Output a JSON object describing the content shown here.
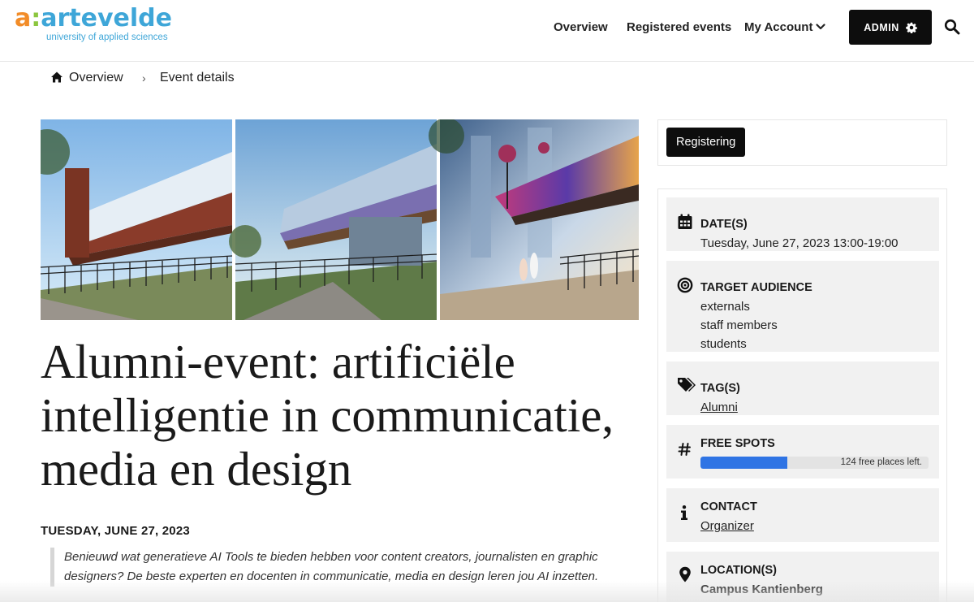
{
  "brand": {
    "logo_a": "a",
    "logo_colon": ":",
    "logo_word": "artevelde",
    "logo_sub": "university of applied sciences"
  },
  "nav": {
    "overview": "Overview",
    "registered": "Registered events",
    "account": "My Account",
    "admin": "ADMIN"
  },
  "breadcrumb": {
    "overview": "Overview",
    "separator": "›",
    "current": "Event details"
  },
  "event": {
    "title": "Alumni-event: artificiële intelli­gentie in communicatie, media en design",
    "date_heading": "TUESDAY, JUNE 27, 2023",
    "intro": "Benieuwd wat generatieve AI Tools te bieden hebben voor content creators, journalisten en graphic designers? De beste experten en docenten in communicatie, media en design leren jou AI inzetten."
  },
  "sidebar": {
    "register_button": "Registering",
    "date": {
      "title": "DATE(S)",
      "value": "Tuesday, June 27, 2023 13:00-19:00"
    },
    "audience": {
      "title": "TARGET AUDIENCE",
      "items": [
        "externals",
        "staff members",
        "students"
      ]
    },
    "tags": {
      "title": "TAG(S)",
      "value": "Alumni"
    },
    "spots": {
      "title": "FREE SPOTS",
      "label": "124 free places left.",
      "fill_fraction": 0.38
    },
    "contact": {
      "title": "CONTACT",
      "value": "Organizer"
    },
    "location": {
      "title": "LOCATION(S)",
      "value": "Campus Kantienberg"
    }
  },
  "colors": {
    "brand_blue": "#3ea6d8",
    "brand_orange": "#f28c28",
    "brand_green": "#8cc63f",
    "progress_blue": "#2f74e4",
    "button_black": "#0d0d0d"
  },
  "icons": {
    "home": "home-icon",
    "chevron": "chevron-down-icon",
    "gear": "gear-icon",
    "search": "search-icon",
    "calendar": "calendar-icon",
    "target": "target-icon",
    "tag": "tag-icon",
    "hash": "hash-icon",
    "info": "info-icon",
    "pin": "map-pin-icon"
  }
}
